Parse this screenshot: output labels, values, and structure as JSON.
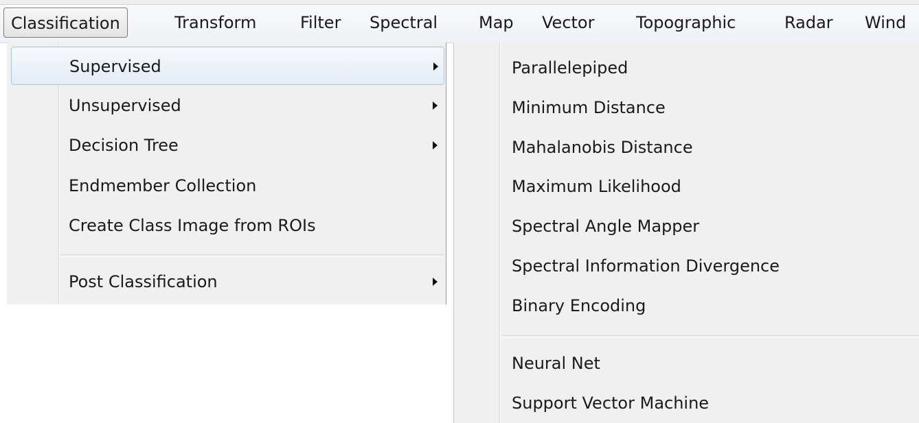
{
  "menubar": {
    "items": [
      {
        "label": "Classification"
      },
      {
        "label": "Transform"
      },
      {
        "label": "Filter"
      },
      {
        "label": "Spectral"
      },
      {
        "label": "Map"
      },
      {
        "label": "Vector"
      },
      {
        "label": "Topographic"
      },
      {
        "label": "Radar"
      },
      {
        "label": "Wind"
      }
    ]
  },
  "classification_menu": {
    "items": [
      {
        "label": "Supervised",
        "has_submenu": true
      },
      {
        "label": "Unsupervised",
        "has_submenu": true
      },
      {
        "label": "Decision Tree",
        "has_submenu": true
      },
      {
        "label": "Endmember Collection",
        "has_submenu": false
      },
      {
        "label": "Create Class Image from ROIs",
        "has_submenu": false
      },
      {
        "label": "Post Classification",
        "has_submenu": true
      }
    ]
  },
  "supervised_submenu": {
    "items": [
      {
        "label": "Parallelepiped"
      },
      {
        "label": "Minimum Distance"
      },
      {
        "label": "Mahalanobis Distance"
      },
      {
        "label": "Maximum Likelihood"
      },
      {
        "label": "Spectral Angle Mapper"
      },
      {
        "label": "Spectral Information Divergence"
      },
      {
        "label": "Binary Encoding"
      },
      {
        "label": "Neural Net"
      },
      {
        "label": "Support Vector Machine"
      }
    ]
  },
  "icons": {
    "submenu_arrow": "chevron-right-icon"
  },
  "colors": {
    "menu_background": "#f0f0f0",
    "hover_border": "#a9c5e6",
    "hover_fill": "#e3ecf8"
  }
}
